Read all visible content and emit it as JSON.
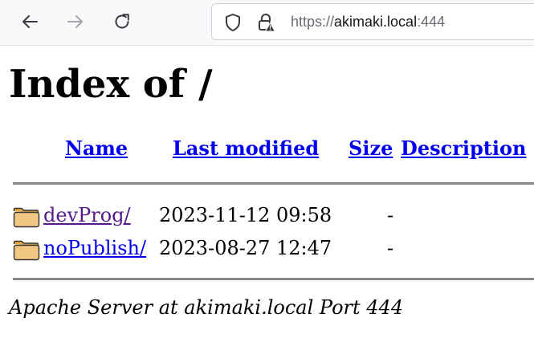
{
  "browser": {
    "url": {
      "scheme": "https://",
      "host": "akimaki.local",
      "port": ":444"
    },
    "icons": {
      "back": "arrow-left-icon",
      "forward": "arrow-right-icon",
      "reload": "reload-icon",
      "tracking": "shield-icon",
      "security": "lock-warning-icon"
    }
  },
  "page": {
    "title": "Index of /",
    "columns": {
      "name": "Name",
      "last_modified": "Last modified",
      "size": "Size",
      "description": "Description"
    },
    "entries": [
      {
        "name": "devProg/",
        "modified": "2023-11-12 09:58",
        "size": "-",
        "description": "",
        "visited": true,
        "icon": "folder-icon"
      },
      {
        "name": "noPublish/",
        "modified": "2023-08-27 12:47",
        "size": "-",
        "description": "",
        "visited": false,
        "icon": "folder-icon"
      }
    ],
    "footer": "Apache Server at akimaki.local Port 444"
  },
  "colors": {
    "link": "#0000ee",
    "visited_link": "#551a8b",
    "rule": "#8a8a8a",
    "toolbar_bg": "#f9f9fb"
  }
}
